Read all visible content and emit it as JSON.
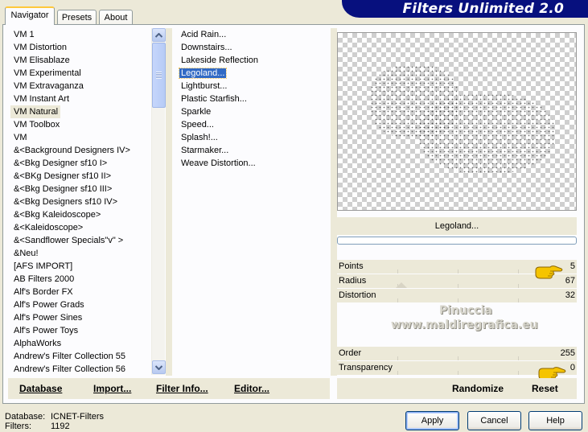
{
  "tabs": [
    "Navigator",
    "Presets",
    "About"
  ],
  "active_tab": "Navigator",
  "banner_title": "Filters Unlimited 2.0",
  "categories": [
    "VM 1",
    "VM Distortion",
    "VM Elisablaze",
    "VM Experimental",
    "VM Extravaganza",
    "VM Instant Art",
    "VM Natural",
    "VM Toolbox",
    "VM",
    "&<Background Designers IV>",
    "&<Bkg Designer sf10 I>",
    "&<BKg Designer sf10 II>",
    "&<Bkg Designer sf10 III>",
    "&<Bkg Designers sf10 IV>",
    "&<Bkg Kaleidoscope>",
    "&<Kaleidoscope>",
    "&<Sandflower Specials\"v\" >",
    "&Neu!",
    "[AFS IMPORT]",
    "AB Filters 2000",
    "Alf's Border FX",
    "Alf's Power Grads",
    "Alf's Power Sines",
    "Alf's Power Toys",
    "AlphaWorks",
    "Andrew's Filter Collection 55",
    "Andrew's Filter Collection 56"
  ],
  "selected_category": "VM Natural",
  "filters": [
    "Acid Rain...",
    "Downstairs...",
    "Lakeside Reflection",
    "Legoland...",
    "Lightburst...",
    "Plastic Starfish...",
    "Sparkle",
    "Speed...",
    "Splash!...",
    "Starmaker...",
    "Weave Distortion..."
  ],
  "selected_filter": "Legoland...",
  "preview_filter_name": "Legoland...",
  "progress_fraction": 0,
  "parameters": {
    "points": {
      "label": "Points",
      "value": "5"
    },
    "radius": {
      "label": "Radius",
      "value": "67"
    },
    "distortion": {
      "label": "Distortion",
      "value": "32"
    },
    "order": {
      "label": "Order",
      "value": "255"
    },
    "transparency": {
      "label": "Transparency",
      "value": "0"
    }
  },
  "watermark": {
    "line1": "Pinuccia",
    "line2": "www.maldiregrafica.eu"
  },
  "toolbar": {
    "database": "Database",
    "import": "Import...",
    "filter_info": "Filter Info...",
    "editor": "Editor...",
    "randomize": "Randomize",
    "reset": "Reset"
  },
  "info": {
    "database_label": "Database:",
    "database_value": "ICNET-Filters",
    "filters_label": "Filters:",
    "filters_value": "1192"
  },
  "buttons": {
    "apply": "Apply",
    "cancel": "Cancel",
    "help": "Help"
  },
  "colors": {
    "banner": "#07107e",
    "selection": "#316ac5",
    "hand": "#f5c400"
  },
  "icons": [
    "scroll-up-arrow-icon",
    "scroll-down-arrow-icon",
    "pointing-hand-icon"
  ]
}
